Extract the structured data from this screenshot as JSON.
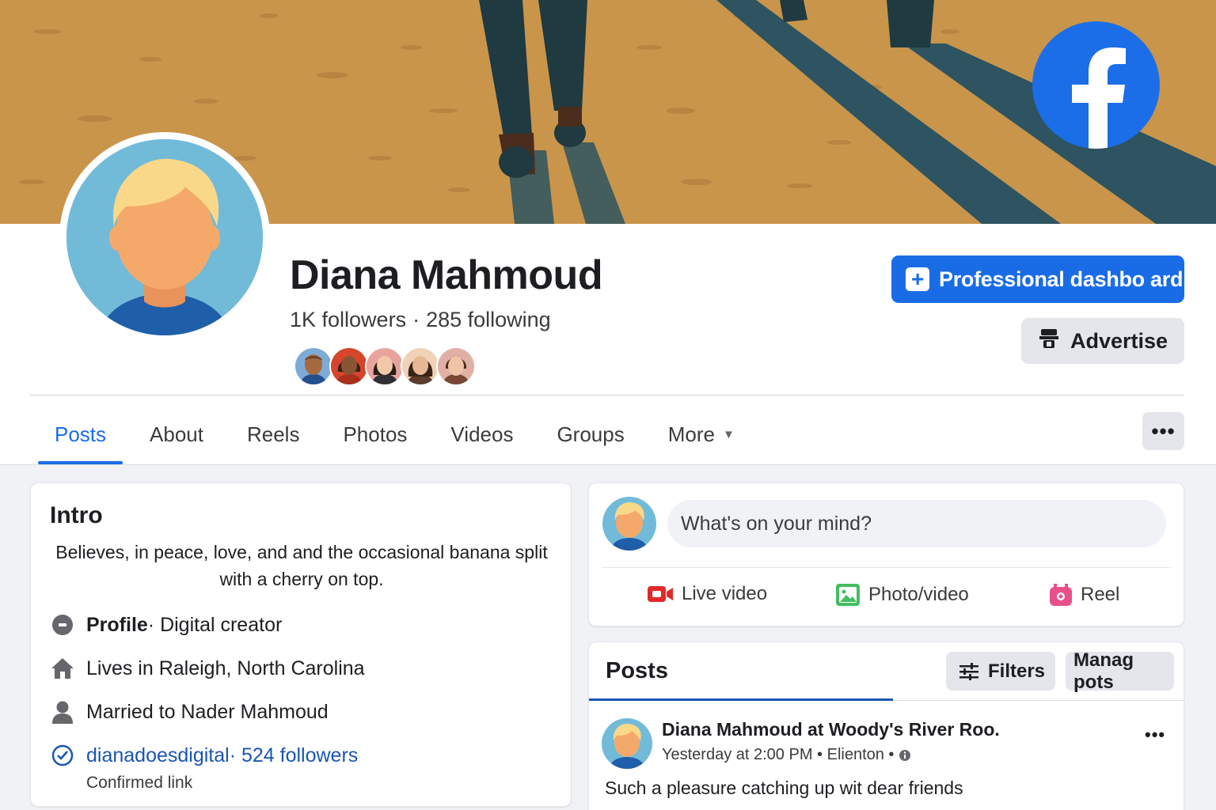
{
  "profile": {
    "name": "Diana Mahmoud",
    "followers": "1K followers",
    "following": "285 following"
  },
  "buttons": {
    "professional_dashboard": "Professional dashbo ard",
    "advertise": "Advertise",
    "more_options": "•••"
  },
  "tabs": [
    {
      "label": "Posts",
      "active": true
    },
    {
      "label": "About"
    },
    {
      "label": "Reels"
    },
    {
      "label": "Photos"
    },
    {
      "label": "Videos"
    },
    {
      "label": "Groups"
    },
    {
      "label": "More"
    }
  ],
  "intro": {
    "title": "Intro",
    "bio": "Believes, in peace, love, and and the occasional banana split with a cherry on top.",
    "profile_label": "Profile",
    "profile_category": " · Digital creator",
    "lives_in": "Lives in Raleigh, North Carolina",
    "married_to": "Married to Nader Mahmoud",
    "link_name": "dianadoesdigital",
    "link_followers": " · 524 followers",
    "link_note": "Confirmed link"
  },
  "composer": {
    "placeholder": "What's on your mind?",
    "actions": [
      "Live video",
      "Photo/video",
      "Reel"
    ]
  },
  "posts": {
    "title": "Posts",
    "filters": "Filters",
    "manage": "Manag pots",
    "post": {
      "title": "Diana Mahmoud at Woody's River Roo.",
      "meta": "Yesterday at 2:00 PM • Elienton •",
      "menu": "•••",
      "text": "Such a pleasure catching up wit dear friends"
    }
  },
  "colors": {
    "brand_blue": "#1a6ce6",
    "cover_sand": "#c9954b",
    "cover_shadow": "#2d5460"
  }
}
